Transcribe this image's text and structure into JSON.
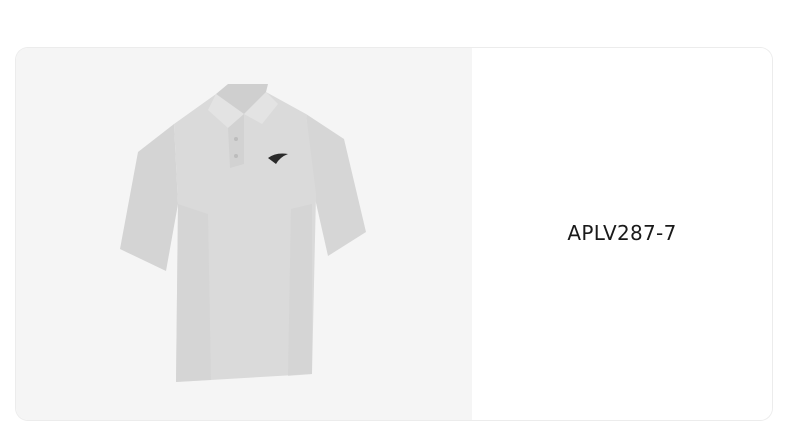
{
  "product": {
    "code": "APLV287-7",
    "image_icon": "polo-shirt-image",
    "shirt_color": "#d9d9d9",
    "logo_color": "#2a2a2a"
  },
  "colors": {
    "image_background": "#f5f5f5",
    "card_background": "#ffffff",
    "text": "#1a1a1a"
  }
}
